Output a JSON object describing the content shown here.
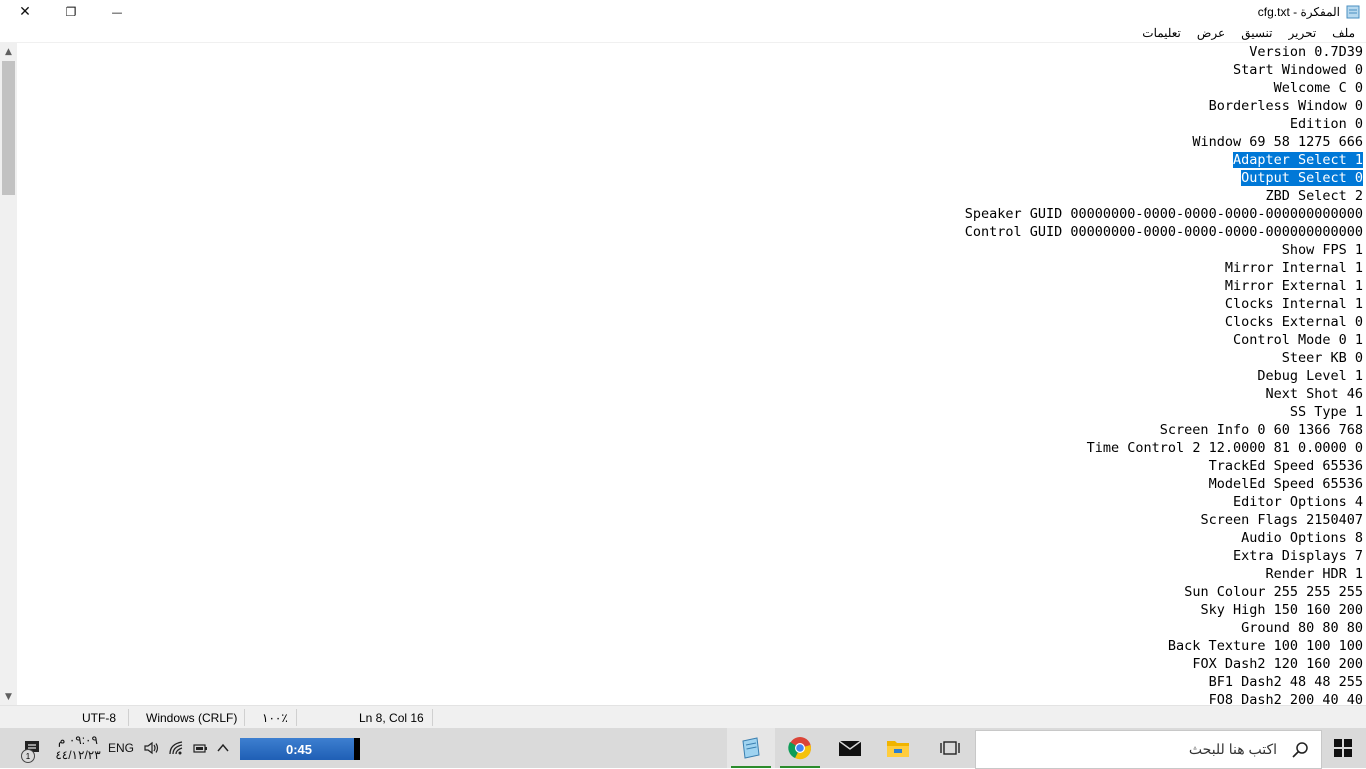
{
  "window": {
    "title": "المفكرة - cfg.txt",
    "close_glyph": "✕",
    "restore_glyph": "❐",
    "minimize_glyph": "—"
  },
  "menu": [
    "ملف",
    "تحرير",
    "تنسيق",
    "عرض",
    "تعليمات"
  ],
  "editor": {
    "lines": [
      {
        "text": "Version 0.7D39",
        "selected": false
      },
      {
        "text": "Start Windowed 0",
        "selected": false
      },
      {
        "text": "Welcome C 0",
        "selected": false
      },
      {
        "text": "Borderless Window 0",
        "selected": false
      },
      {
        "text": "Edition 0",
        "selected": false
      },
      {
        "text": "Window 69 58 1275 666",
        "selected": false
      },
      {
        "text": "Adapter Select 1",
        "selected": true
      },
      {
        "text": "Output Select 0",
        "selected": true
      },
      {
        "text": "ZBD Select 2",
        "selected": false
      },
      {
        "text": "Speaker GUID 00000000-0000-0000-0000-000000000000",
        "selected": false
      },
      {
        "text": "Control GUID 00000000-0000-0000-0000-000000000000",
        "selected": false
      },
      {
        "text": "Show FPS 1",
        "selected": false
      },
      {
        "text": "Mirror Internal 1",
        "selected": false
      },
      {
        "text": "Mirror External 1",
        "selected": false
      },
      {
        "text": "Clocks Internal 1",
        "selected": false
      },
      {
        "text": "Clocks External 0",
        "selected": false
      },
      {
        "text": "Control Mode 0 1",
        "selected": false
      },
      {
        "text": "Steer KB 0",
        "selected": false
      },
      {
        "text": "Debug Level 1",
        "selected": false
      },
      {
        "text": "Next Shot 46",
        "selected": false
      },
      {
        "text": "SS Type 1",
        "selected": false
      },
      {
        "text": "Screen Info 0 60 1366 768",
        "selected": false
      },
      {
        "text": "Time Control 2 12.0000 81 0.0000 0",
        "selected": false
      },
      {
        "text": "TrackEd Speed 65536",
        "selected": false
      },
      {
        "text": "ModelEd Speed 65536",
        "selected": false
      },
      {
        "text": "Editor Options 4",
        "selected": false
      },
      {
        "text": "Screen Flags 2150407",
        "selected": false
      },
      {
        "text": "Audio Options 8",
        "selected": false
      },
      {
        "text": "Extra Displays 7",
        "selected": false
      },
      {
        "text": "Render HDR 1",
        "selected": false
      },
      {
        "text": "Sun Colour 255 255 255",
        "selected": false
      },
      {
        "text": "Sky High 150 160 200",
        "selected": false
      },
      {
        "text": "Ground 80 80 80",
        "selected": false
      },
      {
        "text": "Back Texture 100 100 100",
        "selected": false
      },
      {
        "text": "FOX Dash2 120 160 200",
        "selected": false
      },
      {
        "text": "BF1 Dash2 48 48 255",
        "selected": false
      },
      {
        "text": "FO8 Dash2 200 40 40",
        "selected": false
      }
    ]
  },
  "status": {
    "encoding": "UTF-8",
    "line_ending": "Windows (CRLF)",
    "zoom": "١٠٠٪",
    "position": "Ln 8, Col 16"
  },
  "taskbar": {
    "search_placeholder": "اكتب هنا للبحث",
    "timer_label": "0:45",
    "timer_fraction": 0.97,
    "language": "ENG",
    "time": "٠٩:٠٩ م",
    "date": "٤٤/١٢/٢٣",
    "notification_count": "1"
  },
  "colors": {
    "selection": "#0078d7",
    "taskbar_bg": "#dadada",
    "active_app_underline": "#2c8c2c"
  },
  "icons": [
    "close-icon",
    "restore-icon",
    "minimize-icon",
    "notepad-icon",
    "notification-icon",
    "volume-icon",
    "wifi-icon",
    "battery-icon",
    "chevron-up-icon",
    "task-view-icon",
    "file-explorer-icon",
    "mail-icon",
    "chrome-icon",
    "search-icon",
    "windows-start-icon"
  ]
}
